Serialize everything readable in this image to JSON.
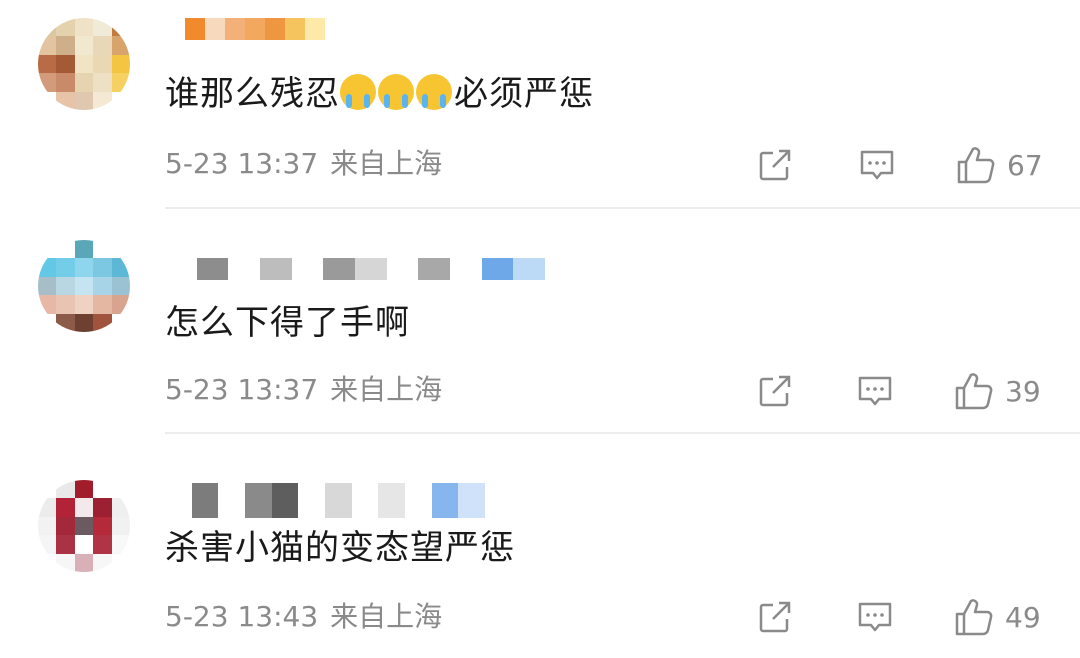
{
  "comments": [
    {
      "text": "谁那么残忍",
      "emojis": [
        "crying-face-emoji",
        "crying-face-emoji",
        "crying-face-emoji"
      ],
      "text_after": "必须严惩",
      "time": "5-23 13:37",
      "location": "来自上海",
      "likes": "67",
      "avatar_colors": [
        "#d9c8a0",
        "#e4d2ac",
        "#efe2c7",
        "#f0ead8",
        "#c27b3d",
        "#e2c4a0",
        "#cfaf8a",
        "#f2e7cf",
        "#e9d8b8",
        "#d9a46b",
        "#b86b45",
        "#a55a36",
        "#f1e4c5",
        "#ead7b4",
        "#f4c542",
        "#d49b7a",
        "#c98a6a",
        "#e6d3b0",
        "#ede0c4",
        "#f6d061",
        "#ffffff",
        "#e7c3a8",
        "#e0c8b0",
        "#f5e9d4",
        "#ffffff"
      ],
      "username_colors": [
        "#ffffff",
        "#f08a2c",
        "#f7d9bd",
        "#f4b079",
        "#f3a85f",
        "#ef9640",
        "#f5c45e",
        "#ffe9a8"
      ]
    },
    {
      "text": "怎么下得了手啊",
      "emojis": [],
      "text_after": "",
      "time": "5-23 13:37",
      "location": "来自上海",
      "likes": "39",
      "avatar_colors": [
        "#ffffff",
        "#ffffff",
        "#5aa7b8",
        "#ffffff",
        "#ffffff",
        "#62c8e6",
        "#74cde8",
        "#8ed6ee",
        "#7cc7e2",
        "#5cb8d6",
        "#a7bdc8",
        "#b9d6e3",
        "#c4e4f1",
        "#a8d4e8",
        "#9bc2d3",
        "#e7b8a6",
        "#e9c4b2",
        "#eed2c2",
        "#e3b7a1",
        "#d8a48f",
        "#ffffff",
        "#8c5a48",
        "#6d4031",
        "#a0543e",
        "#ffffff"
      ],
      "username_colors": [
        "#ffffff",
        "#8d8d8d",
        "#ffffff",
        "#bdbdbd",
        "#ffffff",
        "#9a9a9a",
        "#d6d6d6",
        "#ffffff",
        "#a8a8a8",
        "#ffffff",
        "#6fa8e8",
        "#bcd9f6"
      ]
    },
    {
      "text": "杀害小猫的变态望严惩",
      "emojis": [],
      "text_after": "",
      "time": "5-23 13:43",
      "location": "来自上海",
      "likes": "49",
      "avatar_colors": [
        "#ffffff",
        "#e9e9e9",
        "#a21d2c",
        "#ffffff",
        "#ffffff",
        "#ececec",
        "#b32337",
        "#f3e9ea",
        "#9c2031",
        "#efefef",
        "#f2f2f2",
        "#a2283a",
        "#6b5a60",
        "#b42a3b",
        "#f1f1f1",
        "#f5f5f5",
        "#a93244",
        "#ffffff",
        "#b13346",
        "#f8f8f8",
        "#ffffff",
        "#f6f6f6",
        "#d9b0b7",
        "#f7f7f7",
        "#ffffff"
      ],
      "username_colors": [
        "#ffffff",
        "#7c7c7c",
        "#ffffff",
        "#8a8a8a",
        "#5e5e5e",
        "#ffffff",
        "#d8d8d8",
        "#ffffff",
        "#e6e6e6",
        "#ffffff",
        "#87b6ef",
        "#cfe2f9"
      ]
    }
  ]
}
